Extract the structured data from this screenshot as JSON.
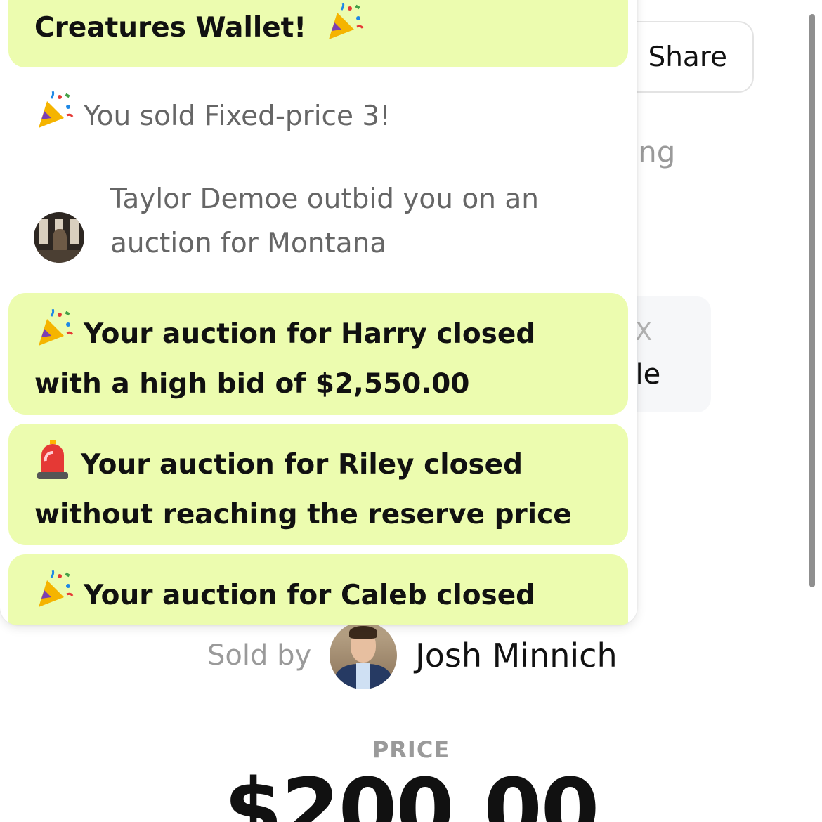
{
  "page": {
    "share_label": "Share",
    "listing_fragment": "ting",
    "card_label_fragment": "EX",
    "card_value_fragment": "ale",
    "sold_by_label": "Sold by",
    "seller_name": "Josh Minnich",
    "price_label": "PRICE",
    "price_value": "$200.00"
  },
  "notifications": [
    {
      "emoji": "party-popper-icon",
      "text": "Creatures Wallet!",
      "emoji_after": true,
      "highlight": true
    },
    {
      "emoji": "party-popper-icon",
      "text": "You sold Fixed-price 3!",
      "highlight": false
    },
    {
      "avatar": "avatar-taylor",
      "text": "Taylor Demoe outbid you on an auction for Montana",
      "highlight": false
    },
    {
      "emoji": "party-popper-icon",
      "text": "Your auction for Harry closed with a high bid of $2,550.00",
      "highlight": true
    },
    {
      "emoji": "siren-icon",
      "text": "Your auction for Riley closed without reaching the reserve price",
      "highlight": true
    },
    {
      "emoji": "party-popper-icon",
      "text": "Your auction for Caleb closed with a",
      "highlight": true
    }
  ],
  "colors": {
    "highlight_bg": "#ecfcaf",
    "muted_text": "#666666",
    "label_gray": "#9a9a9a"
  }
}
